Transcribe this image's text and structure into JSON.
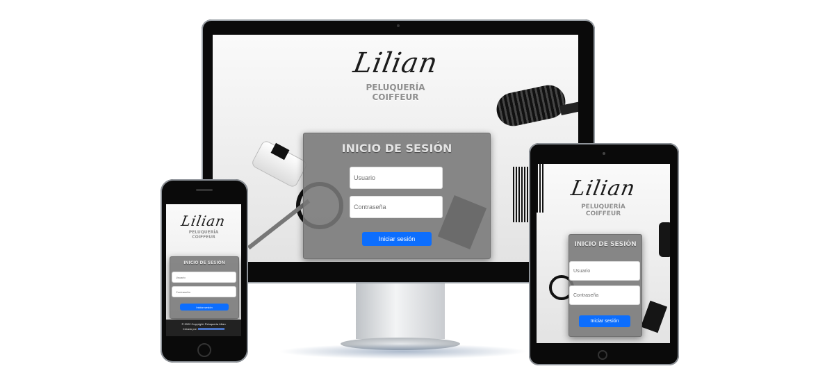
{
  "brand": {
    "logo": "Lilian",
    "subtitle_line1": "PELUQUERÍA",
    "subtitle_line2": "COIFFEUR"
  },
  "login": {
    "title": "INICIO DE SESIÓN",
    "username_placeholder": "Usuario",
    "password_placeholder": "Contraseña",
    "submit_label": "Iniciar sesión"
  },
  "footer": {
    "copyright": "© 2022 Copyright: Peluquería Lilian",
    "created_by": "Creado por:"
  },
  "colors": {
    "accent": "#0d6efd",
    "panel": "#787878",
    "device_frame": "#0a0a0a"
  }
}
